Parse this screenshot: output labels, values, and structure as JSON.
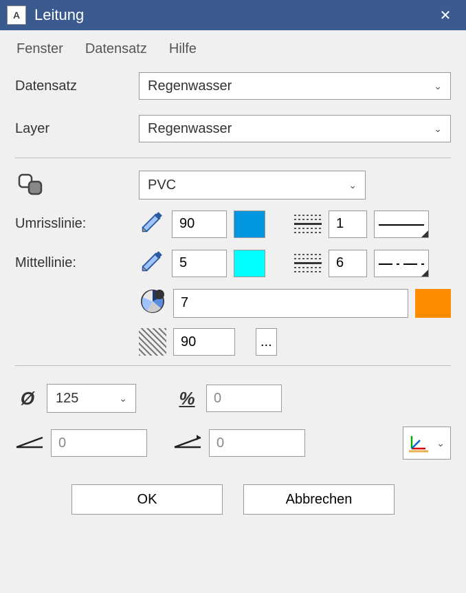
{
  "window": {
    "title": "Leitung"
  },
  "menu": {
    "fenster": "Fenster",
    "datensatz": "Datensatz",
    "hilfe": "Hilfe"
  },
  "fields": {
    "datensatz_label": "Datensatz",
    "datensatz_value": "Regenwasser",
    "layer_label": "Layer",
    "layer_value": "Regenwasser"
  },
  "material": {
    "value": "PVC",
    "umrisslinie_label": "Umrisslinie:",
    "umrisslinie_thickness": "90",
    "umrisslinie_color": "#0096E0",
    "umrisslinie_line_index": "1",
    "mittellinie_label": "Mittellinie:",
    "mittellinie_thickness": "5",
    "mittellinie_color": "#00FFFF",
    "mittellinie_line_index": "6",
    "fill_color_index": "7",
    "fill_color": "#FF8C00",
    "hatch_angle": "90",
    "more_btn": "..."
  },
  "dimensions": {
    "diameter_value": "125",
    "percent_value": "0",
    "slope_in_value": "0",
    "slope_out_value": "0"
  },
  "buttons": {
    "ok": "OK",
    "cancel": "Abbrechen"
  }
}
